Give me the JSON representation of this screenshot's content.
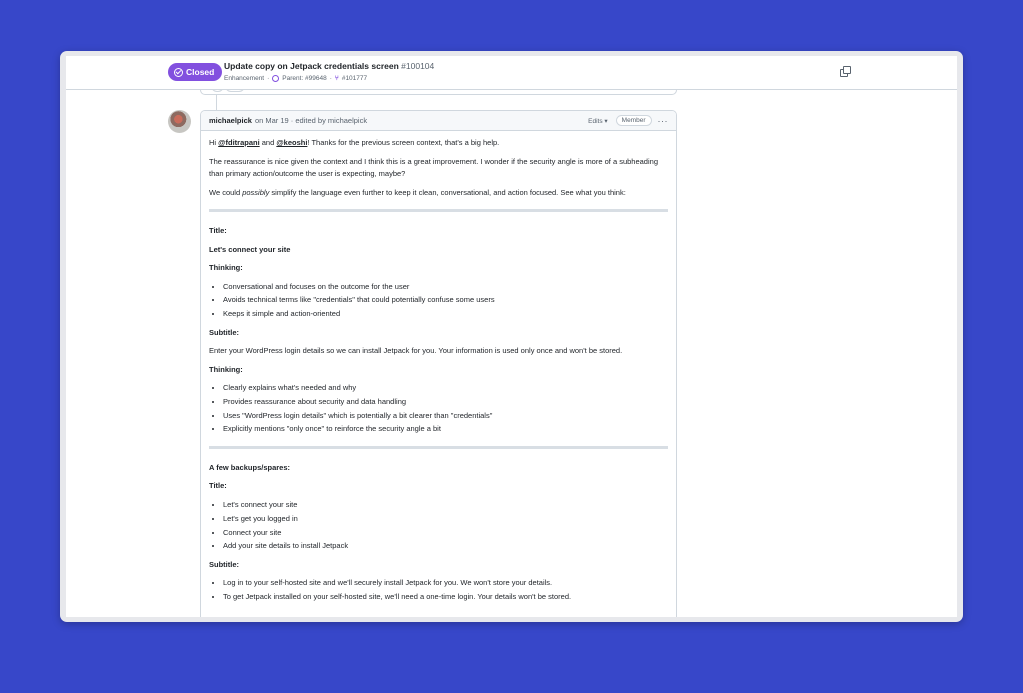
{
  "issue": {
    "state": "Closed",
    "title": "Update copy on Jetpack credentials screen",
    "number": "#100104",
    "label": "Enhancement",
    "parent": "Parent: #99648",
    "linked_pr": "#101777"
  },
  "comment": {
    "author": "michaelpick",
    "meta": "on Mar 19 · edited by michaelpick",
    "edits_label": "Edits ▾",
    "role_badge": "Member",
    "menu_label": "···",
    "intro": {
      "hi": "Hi ",
      "mention1": "@fditrapani",
      "and": " and ",
      "mention2": "@keoshi",
      "thanks": "! Thanks for the previous screen context, that's a big help."
    },
    "para2": "The reassurance is nice given the context and I think this is a great improvement. I wonder if the security angle is more of a subheading than primary action/outcome the user is expecting, maybe?",
    "para3": {
      "a": "We could ",
      "em": "possibly",
      "b": " simplify the language even further to keep it clean, conversational, and action focused. See what you think:"
    },
    "section1": {
      "title_label": "Title:",
      "title_value": "Let's connect your site",
      "thinking1_label": "Thinking:",
      "thinking1": [
        "Conversational and focuses on the outcome for the user",
        "Avoids technical terms like \"credentials\" that could potentially confuse some users",
        "Keeps it simple and action-oriented"
      ],
      "subtitle_label": "Subtitle:",
      "subtitle_value": "Enter your WordPress login details so we can install Jetpack for you. Your information is used only once and won't be stored.",
      "thinking2_label": "Thinking:",
      "thinking2": [
        "Clearly explains what's needed and why",
        "Provides reassurance about security and data handling",
        "Uses \"WordPress login details\" which is potentially a bit clearer than \"credentials\"",
        "Explicitly mentions \"only once\" to reinforce the security angle a bit"
      ]
    },
    "section2": {
      "heading": "A few backups/spares:",
      "title_label": "Title:",
      "titles": [
        "Let's connect your site",
        "Let's get you logged in",
        "Connect your site",
        "Add your site details to install Jetpack"
      ],
      "subtitle_label": "Subtitle:",
      "subtitles": [
        "Log in to your self-hosted site and we'll securely install Jetpack for you. We won't store your details.",
        "To get Jetpack installed on your self-hosted site, we'll need a one-time login. Your details won't be stored."
      ]
    }
  },
  "colors": {
    "background": "#3747c9",
    "closed_badge": "#8250df"
  }
}
